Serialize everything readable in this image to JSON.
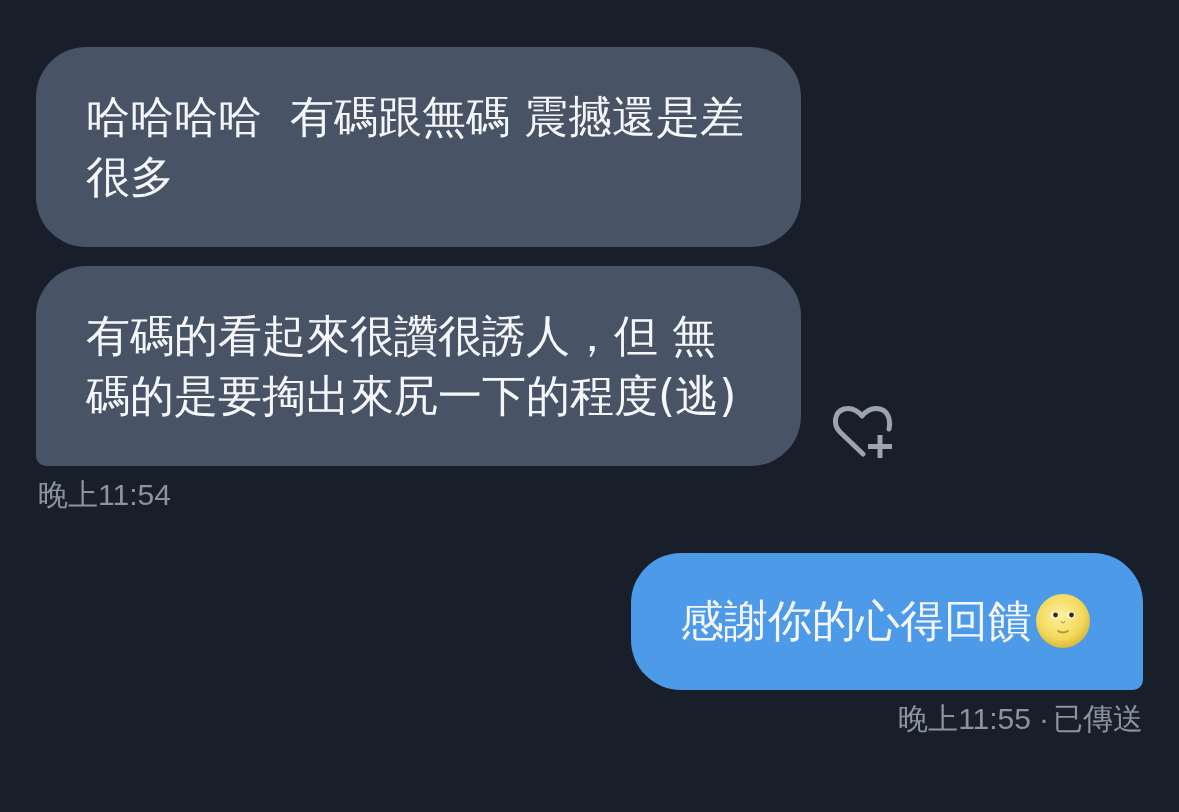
{
  "groups": [
    {
      "kind": "incoming",
      "messages": [
        {
          "text": "哈哈哈哈  有碼跟無碼 震撼還是差很多",
          "tail": false
        },
        {
          "text": "有碼的看起來很讚很誘人，但 無碼的是要掏出來尻一下的程度(逃)",
          "tail": true,
          "reaction_button": true
        }
      ],
      "time": "晚上11:54"
    },
    {
      "kind": "outgoing",
      "messages": [
        {
          "text": "感謝你的心得回饋",
          "tail": true,
          "emoji_after": true
        }
      ],
      "time": "晚上11:55",
      "separator": "·",
      "status": "已傳送"
    }
  ]
}
